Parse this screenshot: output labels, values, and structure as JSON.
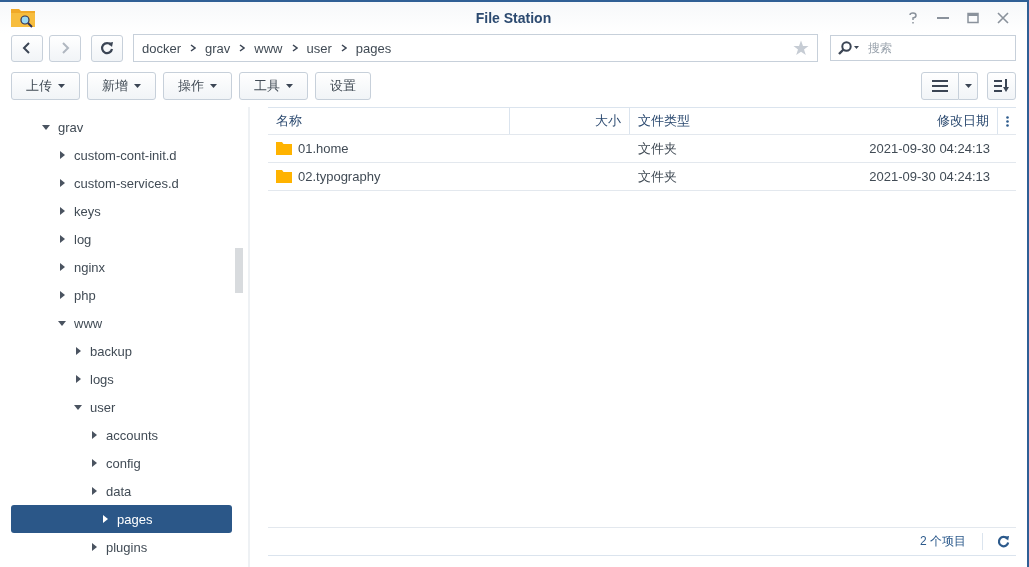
{
  "window": {
    "title": "File Station"
  },
  "path": [
    "docker",
    "grav",
    "www",
    "user",
    "pages"
  ],
  "search": {
    "placeholder": "搜索"
  },
  "toolbar": [
    {
      "label": "上传",
      "dropdown": true
    },
    {
      "label": "新增",
      "dropdown": true
    },
    {
      "label": "操作",
      "dropdown": true
    },
    {
      "label": "工具",
      "dropdown": true
    },
    {
      "label": "设置",
      "dropdown": false
    }
  ],
  "tree": [
    {
      "label": "grav",
      "expanded": true,
      "selected": false,
      "children": [
        {
          "label": "custom-cont-init.d",
          "expanded": false,
          "selected": false
        },
        {
          "label": "custom-services.d",
          "expanded": false,
          "selected": false
        },
        {
          "label": "keys",
          "expanded": false,
          "selected": false
        },
        {
          "label": "log",
          "expanded": false,
          "selected": false
        },
        {
          "label": "nginx",
          "expanded": false,
          "selected": false
        },
        {
          "label": "php",
          "expanded": false,
          "selected": false
        },
        {
          "label": "www",
          "expanded": true,
          "selected": false,
          "children": [
            {
              "label": "backup",
              "expanded": false,
              "selected": false
            },
            {
              "label": "logs",
              "expanded": false,
              "selected": false
            },
            {
              "label": "user",
              "expanded": true,
              "selected": false,
              "children": [
                {
                  "label": "accounts",
                  "expanded": false,
                  "selected": false
                },
                {
                  "label": "config",
                  "expanded": false,
                  "selected": false
                },
                {
                  "label": "data",
                  "expanded": false,
                  "selected": false
                },
                {
                  "label": "pages",
                  "expanded": false,
                  "selected": true
                },
                {
                  "label": "plugins",
                  "expanded": false,
                  "selected": false
                }
              ]
            }
          ]
        }
      ]
    }
  ],
  "table": {
    "columns": [
      "名称",
      "大小",
      "文件类型",
      "修改日期"
    ],
    "rows": [
      {
        "name": "01.home",
        "type": "文件夹",
        "modified": "2021-09-30 04:24:13"
      },
      {
        "name": "02.typography",
        "type": "文件夹",
        "modified": "2021-09-30 04:24:13"
      }
    ]
  },
  "status_bar": {
    "count": "2 个项目"
  }
}
